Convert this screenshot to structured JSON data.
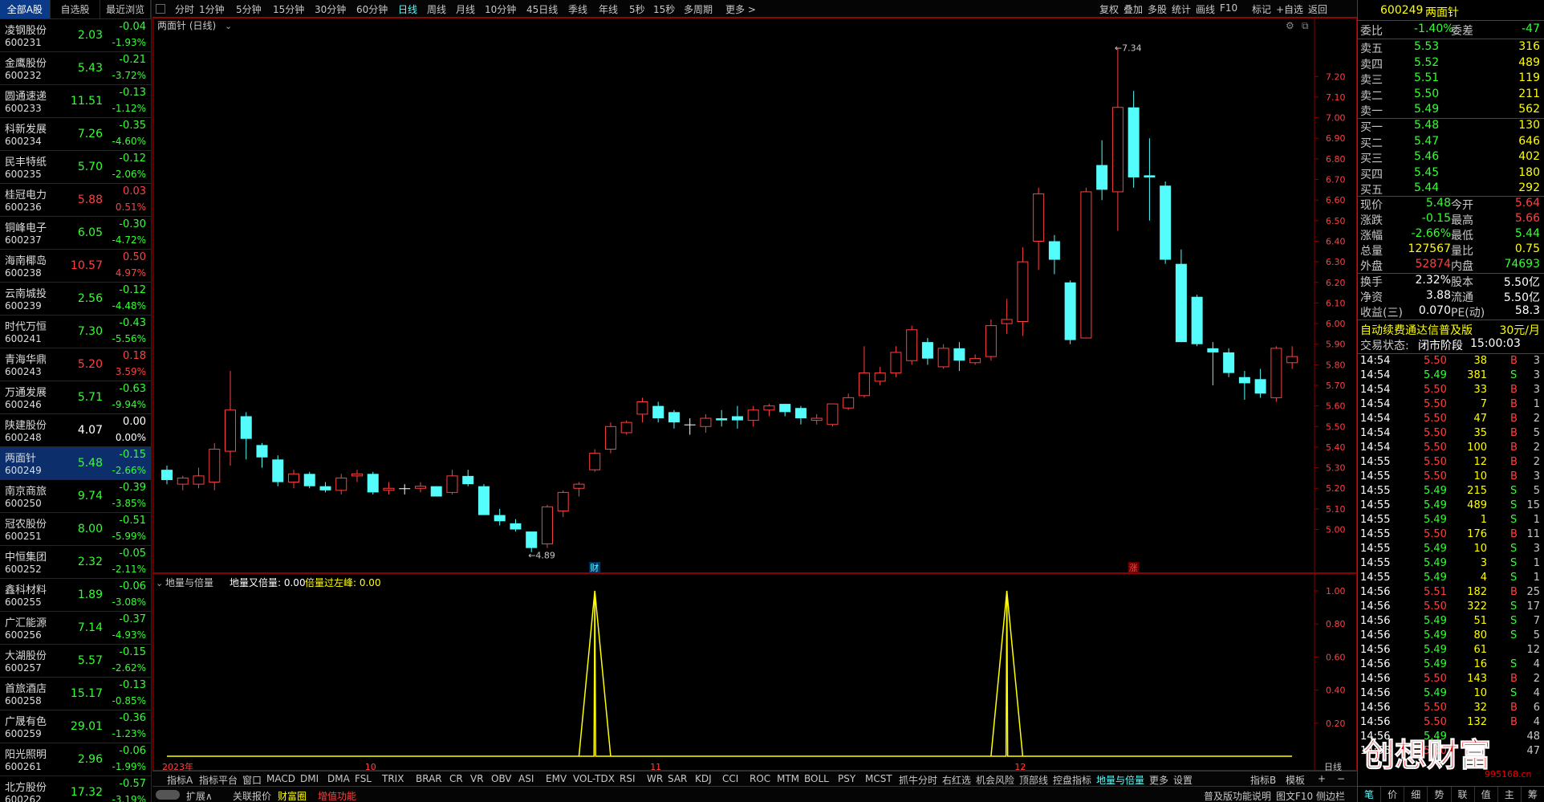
{
  "left_tabs": [
    "全部A股",
    "自选股",
    "最近浏览"
  ],
  "stocks": [
    {
      "name": "凌钢股份",
      "code": "600231",
      "price": "2.03",
      "change": "-0.04",
      "pct": "-1.93%",
      "dir": "down"
    },
    {
      "name": "金鹰股份",
      "code": "600232",
      "price": "5.43",
      "change": "-0.21",
      "pct": "-3.72%",
      "dir": "down"
    },
    {
      "name": "圆通速递",
      "code": "600233",
      "price": "11.51",
      "change": "-0.13",
      "pct": "-1.12%",
      "dir": "down"
    },
    {
      "name": "科新发展",
      "code": "600234",
      "price": "7.26",
      "change": "-0.35",
      "pct": "-4.60%",
      "dir": "down"
    },
    {
      "name": "民丰特纸",
      "code": "600235",
      "price": "5.70",
      "change": "-0.12",
      "pct": "-2.06%",
      "dir": "down"
    },
    {
      "name": "桂冠电力",
      "code": "600236",
      "price": "5.88",
      "change": "0.03",
      "pct": "0.51%",
      "dir": "up"
    },
    {
      "name": "铜峰电子",
      "code": "600237",
      "price": "6.05",
      "change": "-0.30",
      "pct": "-4.72%",
      "dir": "down"
    },
    {
      "name": "海南椰岛",
      "code": "600238",
      "price": "10.57",
      "change": "0.50",
      "pct": "4.97%",
      "dir": "up"
    },
    {
      "name": "云南城投",
      "code": "600239",
      "price": "2.56",
      "change": "-0.12",
      "pct": "-4.48%",
      "dir": "down"
    },
    {
      "name": "时代万恒",
      "code": "600241",
      "price": "7.30",
      "change": "-0.43",
      "pct": "-5.56%",
      "dir": "down"
    },
    {
      "name": "青海华鼎",
      "code": "600243",
      "price": "5.20",
      "change": "0.18",
      "pct": "3.59%",
      "dir": "up"
    },
    {
      "name": "万通发展",
      "code": "600246",
      "price": "5.71",
      "change": "-0.63",
      "pct": "-9.94%",
      "dir": "down"
    },
    {
      "name": "陕建股份",
      "code": "600248",
      "price": "4.07",
      "change": "0.00",
      "pct": "0.00%",
      "dir": "flat"
    },
    {
      "name": "两面针",
      "code": "600249",
      "price": "5.48",
      "change": "-0.15",
      "pct": "-2.66%",
      "dir": "down",
      "selected": true
    },
    {
      "name": "南京商旅",
      "code": "600250",
      "price": "9.74",
      "change": "-0.39",
      "pct": "-3.85%",
      "dir": "down"
    },
    {
      "name": "冠农股份",
      "code": "600251",
      "price": "8.00",
      "change": "-0.51",
      "pct": "-5.99%",
      "dir": "down"
    },
    {
      "name": "中恒集团",
      "code": "600252",
      "price": "2.32",
      "change": "-0.05",
      "pct": "-2.11%",
      "dir": "down"
    },
    {
      "name": "鑫科材料",
      "code": "600255",
      "price": "1.89",
      "change": "-0.06",
      "pct": "-3.08%",
      "dir": "down"
    },
    {
      "name": "广汇能源",
      "code": "600256",
      "price": "7.14",
      "change": "-0.37",
      "pct": "-4.93%",
      "dir": "down"
    },
    {
      "name": "大湖股份",
      "code": "600257",
      "price": "5.57",
      "change": "-0.15",
      "pct": "-2.62%",
      "dir": "down"
    },
    {
      "name": "首旅酒店",
      "code": "600258",
      "price": "15.17",
      "change": "-0.13",
      "pct": "-0.85%",
      "dir": "down"
    },
    {
      "name": "广晟有色",
      "code": "600259",
      "price": "29.01",
      "change": "-0.36",
      "pct": "-1.23%",
      "dir": "down"
    },
    {
      "name": "阳光照明",
      "code": "600261",
      "price": "2.96",
      "change": "-0.06",
      "pct": "-1.99%",
      "dir": "down"
    },
    {
      "name": "北方股份",
      "code": "600262",
      "price": "17.32",
      "change": "-0.57",
      "pct": "-3.19%",
      "dir": "down"
    }
  ],
  "period_bar": [
    "分时",
    "1分钟",
    "5分钟",
    "15分钟",
    "30分钟",
    "60分钟",
    "日线",
    "周线",
    "月线",
    "10分钟",
    "45日线",
    "季线",
    "年线",
    "5秒",
    "15秒",
    "多周期",
    "更多 >"
  ],
  "period_active": "日线",
  "tool_bar": [
    "复权",
    "叠加",
    "多股",
    "统计",
    "画线",
    "F10",
    "标记",
    "+自选",
    "返回"
  ],
  "chart_title": "两面针 (日线)",
  "indicator_title": "地量与倍量",
  "indicator_vals": [
    {
      "label": "地量又倍量: 0.00",
      "color": "#fff"
    },
    {
      "label": "倍量过左峰: 0.00",
      "color": "#ff0"
    }
  ],
  "chart_data": {
    "type": "candlestick",
    "dates_labels": [
      "2023年",
      "10",
      "11",
      "12"
    ],
    "candles": [
      [
        5.29,
        5.24,
        5.31,
        5.22
      ],
      [
        5.22,
        5.25,
        5.26,
        5.19
      ],
      [
        5.22,
        5.26,
        5.3,
        5.2
      ],
      [
        5.23,
        5.39,
        5.42,
        5.19
      ],
      [
        5.38,
        5.58,
        5.77,
        5.31
      ],
      [
        5.55,
        5.44,
        5.57,
        5.34
      ],
      [
        5.41,
        5.35,
        5.42,
        5.3
      ],
      [
        5.34,
        5.23,
        5.36,
        5.21
      ],
      [
        5.23,
        5.27,
        5.29,
        5.2
      ],
      [
        5.27,
        5.21,
        5.28,
        5.2
      ],
      [
        5.21,
        5.19,
        5.23,
        5.18
      ],
      [
        5.19,
        5.25,
        5.27,
        5.17
      ],
      [
        5.26,
        5.27,
        5.29,
        5.23
      ],
      [
        5.27,
        5.18,
        5.28,
        5.17
      ],
      [
        5.19,
        5.2,
        5.23,
        5.17
      ],
      [
        5.2,
        5.2,
        5.22,
        5.17
      ],
      [
        5.2,
        5.21,
        5.23,
        5.18
      ],
      [
        5.21,
        5.16,
        5.21,
        5.16
      ],
      [
        5.18,
        5.26,
        5.29,
        5.17
      ],
      [
        5.26,
        5.22,
        5.29,
        5.21
      ],
      [
        5.21,
        5.07,
        5.22,
        5.07
      ],
      [
        5.07,
        5.04,
        5.1,
        5.02
      ],
      [
        5.03,
        5.0,
        5.05,
        4.99
      ],
      [
        4.99,
        4.91,
        4.99,
        4.89
      ],
      [
        4.93,
        5.11,
        5.12,
        4.91
      ],
      [
        5.09,
        5.18,
        5.19,
        5.06
      ],
      [
        5.2,
        5.22,
        5.23,
        5.16
      ],
      [
        5.29,
        5.37,
        5.39,
        5.28
      ],
      [
        5.39,
        5.5,
        5.52,
        5.37
      ],
      [
        5.47,
        5.52,
        5.53,
        5.46
      ],
      [
        5.56,
        5.62,
        5.64,
        5.52
      ],
      [
        5.6,
        5.54,
        5.62,
        5.52
      ],
      [
        5.57,
        5.52,
        5.58,
        5.49
      ],
      [
        5.51,
        5.51,
        5.54,
        5.46
      ],
      [
        5.5,
        5.54,
        5.56,
        5.47
      ],
      [
        5.54,
        5.53,
        5.58,
        5.5
      ],
      [
        5.55,
        5.53,
        5.6,
        5.49
      ],
      [
        5.53,
        5.58,
        5.6,
        5.5
      ],
      [
        5.58,
        5.6,
        5.61,
        5.55
      ],
      [
        5.61,
        5.57,
        5.61,
        5.55
      ],
      [
        5.59,
        5.54,
        5.6,
        5.51
      ],
      [
        5.53,
        5.54,
        5.56,
        5.51
      ],
      [
        5.51,
        5.61,
        5.61,
        5.5
      ],
      [
        5.59,
        5.64,
        5.66,
        5.58
      ],
      [
        5.65,
        5.76,
        5.89,
        5.64
      ],
      [
        5.72,
        5.76,
        5.79,
        5.7
      ],
      [
        5.76,
        5.86,
        5.89,
        5.74
      ],
      [
        5.82,
        5.97,
        5.99,
        5.8
      ],
      [
        5.91,
        5.83,
        5.93,
        5.8
      ],
      [
        5.79,
        5.88,
        5.9,
        5.78
      ],
      [
        5.88,
        5.82,
        5.91,
        5.77
      ],
      [
        5.81,
        5.83,
        5.85,
        5.8
      ],
      [
        5.84,
        5.99,
        6.02,
        5.82
      ],
      [
        6.0,
        6.02,
        6.12,
        5.95
      ],
      [
        6.01,
        6.3,
        6.37,
        5.94
      ],
      [
        6.4,
        6.63,
        6.66,
        6.26
      ],
      [
        6.4,
        6.31,
        6.43,
        6.24
      ],
      [
        6.2,
        5.92,
        6.21,
        5.9
      ],
      [
        5.93,
        6.64,
        6.66,
        5.94
      ],
      [
        6.77,
        6.65,
        6.89,
        6.6
      ],
      [
        6.64,
        7.05,
        7.34,
        6.45
      ],
      [
        7.05,
        6.71,
        7.13,
        6.66
      ],
      [
        6.72,
        6.71,
        6.9,
        6.5
      ],
      [
        6.67,
        6.31,
        6.69,
        6.29
      ],
      [
        6.29,
        5.91,
        6.36,
        6.19
      ],
      [
        6.13,
        5.9,
        6.14,
        5.89
      ],
      [
        5.88,
        5.86,
        5.91,
        5.7
      ],
      [
        5.86,
        5.76,
        5.88,
        5.74
      ],
      [
        5.74,
        5.71,
        5.77,
        5.63
      ],
      [
        5.73,
        5.66,
        5.78,
        5.64
      ],
      [
        5.64,
        5.88,
        5.89,
        5.62
      ],
      [
        5.81,
        5.84,
        5.89,
        5.78
      ]
    ],
    "ylim": [
      4.85,
      7.4
    ],
    "y_ticks": [
      "7.20",
      "7.10",
      "7.00",
      "6.90",
      "6.80",
      "6.70",
      "6.60",
      "6.50",
      "6.40",
      "6.30",
      "6.20",
      "6.10",
      "6.00",
      "5.90",
      "5.80",
      "5.70",
      "5.60",
      "5.50",
      "5.40",
      "5.30",
      "5.20",
      "5.10",
      "5.00"
    ],
    "annotations": [
      {
        "label": "7.34",
        "value": 7.34,
        "index": 60
      },
      {
        "label": "4.89",
        "value": 4.89,
        "index": 23
      }
    ],
    "markers": [
      {
        "label": "财",
        "index": 27,
        "color": "#5ff"
      },
      {
        "label": "涨",
        "index": 61,
        "color": "#ff4040"
      }
    ],
    "indicator": {
      "series": [
        {
          "name": "地量与倍量",
          "spikes": [
            27,
            53
          ]
        }
      ],
      "ylim": [
        0,
        1
      ],
      "y_ticks": [
        "1.00",
        "0.80",
        "0.60",
        "0.40",
        "0.20"
      ]
    },
    "x_tick_positions": [
      0,
      13,
      31,
      54
    ]
  },
  "indicator_tabs": [
    "指标A",
    "指标平台",
    "窗口",
    "MACD",
    "DMI",
    "DMA",
    "FSL",
    "TRIX",
    "BRAR",
    "CR",
    "VR",
    "OBV",
    "ASI",
    "EMV",
    "VOL-TDX",
    "RSI",
    "WR",
    "SAR",
    "KDJ",
    "CCI",
    "ROC",
    "MTM",
    "BOLL",
    "PSY",
    "MCST",
    "抓牛分时",
    "右红选",
    "机会风险",
    "顶部线",
    "控盘指标",
    "地量与倍量",
    "更多",
    "设置"
  ],
  "indicator_active": "地量与倍量",
  "indicator_right": [
    "指标B",
    "模板"
  ],
  "bottom_left": [
    "扩展∧",
    "关联报价",
    "财富圈",
    "增值功能"
  ],
  "bottom_right": [
    "普及版功能说明",
    "图文F10",
    "侧边栏"
  ],
  "right_title": {
    "code": "600249",
    "name": "两面针"
  },
  "weibi": {
    "label": "委比",
    "value": "-1.40%",
    "label2": "委差",
    "value2": "-47"
  },
  "asks": [
    {
      "label": "卖五",
      "price": "5.53",
      "vol": "316"
    },
    {
      "label": "卖四",
      "price": "5.52",
      "vol": "489"
    },
    {
      "label": "卖三",
      "price": "5.51",
      "vol": "119"
    },
    {
      "label": "卖二",
      "price": "5.50",
      "vol": "211"
    },
    {
      "label": "卖一",
      "price": "5.49",
      "vol": "562"
    }
  ],
  "bids": [
    {
      "label": "买一",
      "price": "5.48",
      "vol": "130"
    },
    {
      "label": "买二",
      "price": "5.47",
      "vol": "646"
    },
    {
      "label": "买三",
      "price": "5.46",
      "vol": "402"
    },
    {
      "label": "买四",
      "price": "5.45",
      "vol": "180"
    },
    {
      "label": "买五",
      "price": "5.44",
      "vol": "292"
    }
  ],
  "quote": [
    {
      "l1": "现价",
      "v1": "5.48",
      "c1": "grn",
      "l2": "今开",
      "v2": "5.64",
      "c2": "red"
    },
    {
      "l1": "涨跌",
      "v1": "-0.15",
      "c1": "grn",
      "l2": "最高",
      "v2": "5.66",
      "c2": "red"
    },
    {
      "l1": "涨幅",
      "v1": "-2.66%",
      "c1": "grn",
      "l2": "最低",
      "v2": "5.44",
      "c2": "grn"
    },
    {
      "l1": "总量",
      "v1": "127567",
      "c1": "yel",
      "l2": "量比",
      "v2": "0.75",
      "c2": "yel"
    },
    {
      "l1": "外盘",
      "v1": "52874",
      "c1": "red",
      "l2": "内盘",
      "v2": "74693",
      "c2": "grn"
    }
  ],
  "fundamentals": [
    {
      "l1": "换手",
      "v1": "2.32%",
      "l2": "股本",
      "v2": "5.50亿"
    },
    {
      "l1": "净资",
      "v1": "3.88",
      "l2": "流通",
      "v2": "5.50亿"
    },
    {
      "l1": "收益(三)",
      "v1": "0.070",
      "l2": "PE(动)",
      "v2": "58.3"
    }
  ],
  "promo": {
    "text": "自动续费通达信普及版",
    "price": "30元/月"
  },
  "trade_state": {
    "label": "交易状态:",
    "state": "闭市阶段",
    "time": "15:00:03"
  },
  "ticks": [
    [
      "14:54",
      "5.50",
      "38",
      "B",
      "3"
    ],
    [
      "14:54",
      "5.49",
      "381",
      "S",
      "3"
    ],
    [
      "14:54",
      "5.50",
      "33",
      "B",
      "3"
    ],
    [
      "14:54",
      "5.50",
      "7",
      "B",
      "1"
    ],
    [
      "14:54",
      "5.50",
      "47",
      "B",
      "2"
    ],
    [
      "14:54",
      "5.50",
      "35",
      "B",
      "5"
    ],
    [
      "14:54",
      "5.50",
      "100",
      "B",
      "2"
    ],
    [
      "14:55",
      "5.50",
      "12",
      "B",
      "2"
    ],
    [
      "14:55",
      "5.50",
      "10",
      "B",
      "3"
    ],
    [
      "14:55",
      "5.49",
      "215",
      "S",
      "5"
    ],
    [
      "14:55",
      "5.49",
      "489",
      "S",
      "15"
    ],
    [
      "14:55",
      "5.49",
      "1",
      "S",
      "1"
    ],
    [
      "14:55",
      "5.50",
      "176",
      "B",
      "11"
    ],
    [
      "14:55",
      "5.49",
      "10",
      "S",
      "3"
    ],
    [
      "14:55",
      "5.49",
      "3",
      "S",
      "1"
    ],
    [
      "14:55",
      "5.49",
      "4",
      "S",
      "1"
    ],
    [
      "14:56",
      "5.51",
      "182",
      "B",
      "25"
    ],
    [
      "14:56",
      "5.50",
      "322",
      "S",
      "17"
    ],
    [
      "14:56",
      "5.49",
      "51",
      "S",
      "7"
    ],
    [
      "14:56",
      "5.49",
      "80",
      "S",
      "5"
    ],
    [
      "14:56",
      "5.49",
      "61",
      "",
      "12"
    ],
    [
      "14:56",
      "5.49",
      "16",
      "S",
      "4"
    ],
    [
      "14:56",
      "5.50",
      "143",
      "B",
      "2"
    ],
    [
      "14:56",
      "5.49",
      "10",
      "S",
      "4"
    ],
    [
      "14:56",
      "5.50",
      "32",
      "B",
      "6"
    ],
    [
      "14:56",
      "5.50",
      "132",
      "B",
      "4"
    ],
    [
      "14:56",
      "5.49",
      "",
      "",
      "48"
    ],
    [
      "14:56",
      "5.50",
      "",
      "",
      "47"
    ]
  ],
  "right_bottom_tabs": [
    "笔",
    "价",
    "细",
    "势",
    "联",
    "值",
    "主",
    "筹"
  ],
  "watermark": {
    "text": "创想财富",
    "url": "995168.cn"
  },
  "colors": {
    "up": "#ff4040",
    "down": "#54fcfc",
    "flat": "#ffffff",
    "grid": "#8b0000",
    "indicator": "#ffff00"
  }
}
